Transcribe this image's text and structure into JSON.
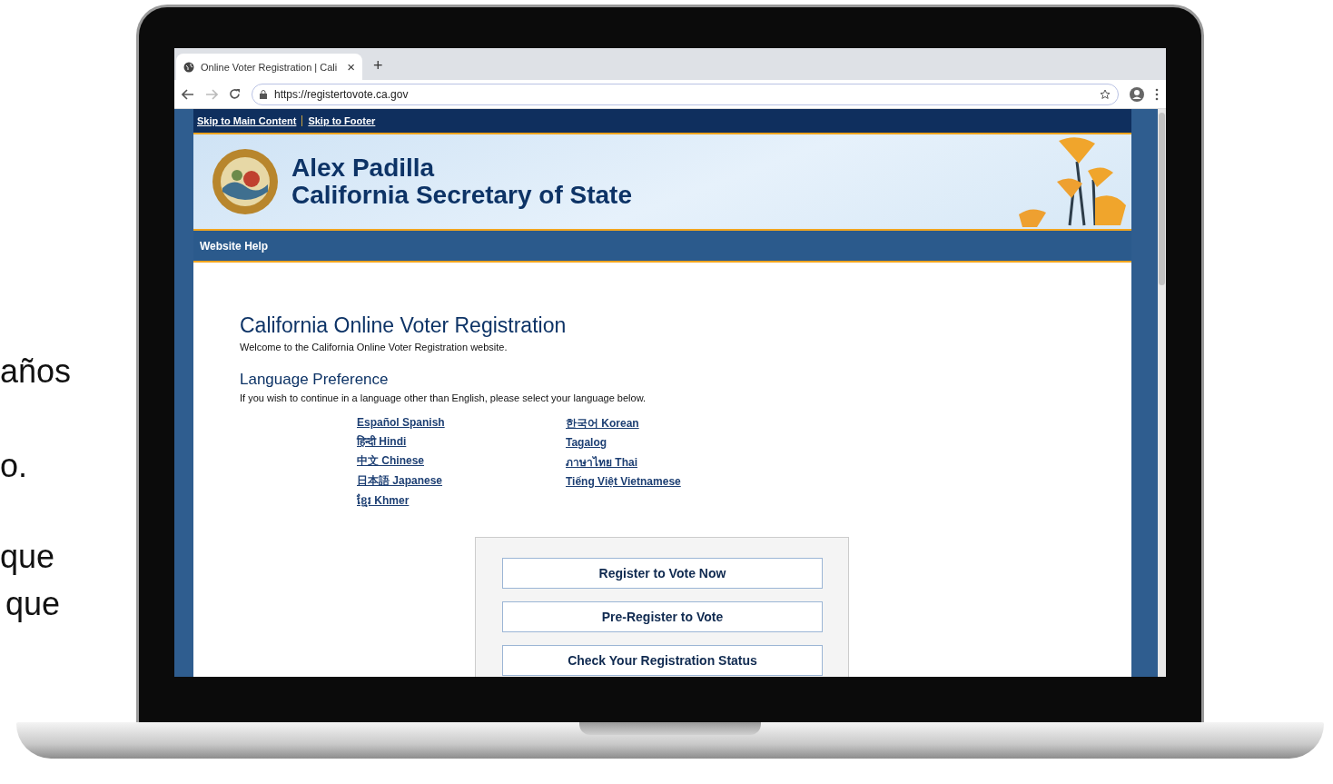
{
  "side_text": [
    "años",
    "o.",
    "que",
    "que"
  ],
  "browser": {
    "tab": {
      "title": "Online Voter Registration | Cali",
      "close": "×"
    },
    "new_tab": "+",
    "url": "https://registertovote.ca.gov"
  },
  "page": {
    "skip_links": [
      "Skip to Main Content",
      "Skip to Footer"
    ],
    "header": {
      "name": "Alex Padilla",
      "title": "California Secretary of State"
    },
    "nav": [
      "Website Help"
    ],
    "heading": "California Online Voter Registration",
    "welcome": "Welcome to the California Online Voter Registration website.",
    "language_heading": "Language Preference",
    "language_intro": "If you wish to continue in a language other than English, please select your language below.",
    "language_columns": [
      {
        "items": [
          "Español Spanish",
          "हिन्दी Hindi",
          "中文 Chinese",
          "日本語 Japanese",
          "ខ្មែរ Khmer"
        ]
      },
      {
        "items": [
          "한국어 Korean",
          "Tagalog",
          "ภาษาไทย Thai",
          "Tiếng Việt Vietnamese"
        ]
      }
    ],
    "buttons": [
      "Register to Vote Now",
      "Pre-Register to Vote",
      "Check Your Registration Status"
    ]
  }
}
